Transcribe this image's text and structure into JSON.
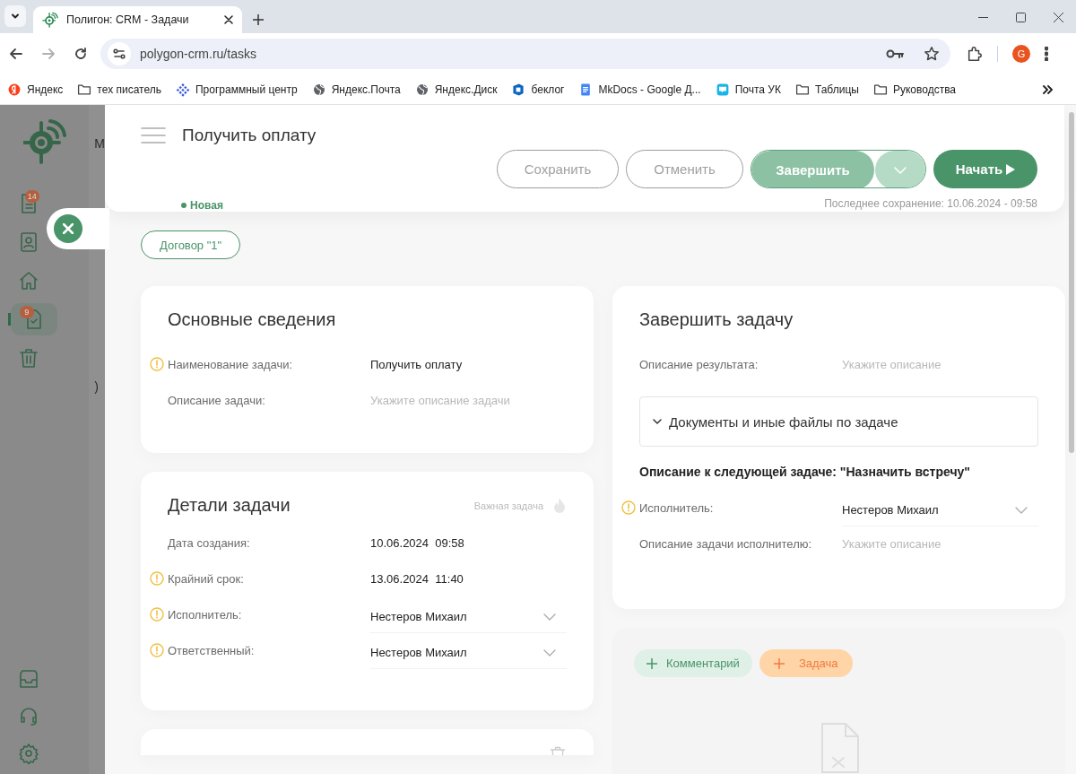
{
  "browser": {
    "tab_title": "Полигон: CRM - Задачи",
    "url": "polygon-crm.ru/tasks",
    "avatar": "G",
    "bookmarks": [
      {
        "label": "Яндекс",
        "kind": "yandex"
      },
      {
        "label": "тех писатель",
        "kind": "folder"
      },
      {
        "label": "Программный центр",
        "kind": "grid"
      },
      {
        "label": "Яндекс.Почта",
        "kind": "globe"
      },
      {
        "label": "Яндекс.Диск",
        "kind": "globe"
      },
      {
        "label": "беклог",
        "kind": "azure"
      },
      {
        "label": "MkDocs - Google Д...",
        "kind": "docs"
      },
      {
        "label": "Почта УК",
        "kind": "mail"
      },
      {
        "label": "Таблицы",
        "kind": "folder"
      },
      {
        "label": "Руководства",
        "kind": "folder"
      }
    ]
  },
  "sidebar": {
    "items": [
      {
        "kind": "documents",
        "badge": "14",
        "selected": false
      },
      {
        "kind": "contacts",
        "selected": false
      },
      {
        "kind": "home",
        "selected": false
      },
      {
        "kind": "tasks",
        "badge": "9",
        "selected": true
      },
      {
        "kind": "trash",
        "selected": false
      }
    ],
    "bottom_items": [
      {
        "kind": "inbox",
        "selected": false
      },
      {
        "kind": "support",
        "selected": false
      },
      {
        "kind": "settings",
        "selected": false
      }
    ],
    "background_fragments": [
      "М",
      ")"
    ]
  },
  "header": {
    "title": "Получить оплату",
    "status": "Новая",
    "buttons": [
      {
        "label": "Сохранить",
        "kind": "outline"
      },
      {
        "label": "Отменить",
        "kind": "outline"
      },
      {
        "label": "Завершить",
        "kind": "split"
      },
      {
        "label": "Начать",
        "kind": "primary"
      }
    ],
    "last_saved": "Последнее сохранение: 10.06.2024 - 09:58"
  },
  "contract_chip": "Договор \"1\"",
  "basic_info": {
    "title": "Основные сведения",
    "fields": [
      {
        "label": "Наименование задачи:",
        "kind": "text",
        "value": "Получить оплату",
        "required": true
      },
      {
        "label": "Описание задачи:",
        "kind": "input",
        "placeholder": "Укажите описание задачи",
        "required": false
      }
    ]
  },
  "details": {
    "title": "Детали задачи",
    "important_label": "Важная задача",
    "important": false,
    "fields": [
      {
        "label": "Дата создания:",
        "kind": "text",
        "value": "10.06.2024  09:58",
        "required": false
      },
      {
        "label": "Крайний срок:",
        "kind": "text",
        "value": "13.06.2024  11:40",
        "required": true
      },
      {
        "label": "Исполнитель:",
        "kind": "select",
        "value": "Нестеров Михаил",
        "required": true
      },
      {
        "label": "Ответственный:",
        "kind": "select",
        "value": "Нестеров Михаил",
        "required": true
      }
    ]
  },
  "complete": {
    "title": "Завершить задачу",
    "fields": [
      {
        "label": "Описание результата:",
        "kind": "input",
        "placeholder": "Укажите описание",
        "required": false
      }
    ],
    "documents": {
      "label": "Документы и иные файлы по задаче",
      "expanded": false
    },
    "next_title": "Описание к следующей задаче: \"Назначить встречу\"",
    "next_fields": [
      {
        "label": "Исполнитель:",
        "kind": "select",
        "value": "Нестеров Михаил",
        "required": true
      },
      {
        "label": "Описание задачи исполнителю:",
        "kind": "input",
        "placeholder": "Укажите описание",
        "required": false
      }
    ]
  },
  "activity": {
    "buttons": [
      {
        "label": "Комментарий",
        "kind": "comment"
      },
      {
        "label": "Задача",
        "kind": "task"
      }
    ]
  }
}
